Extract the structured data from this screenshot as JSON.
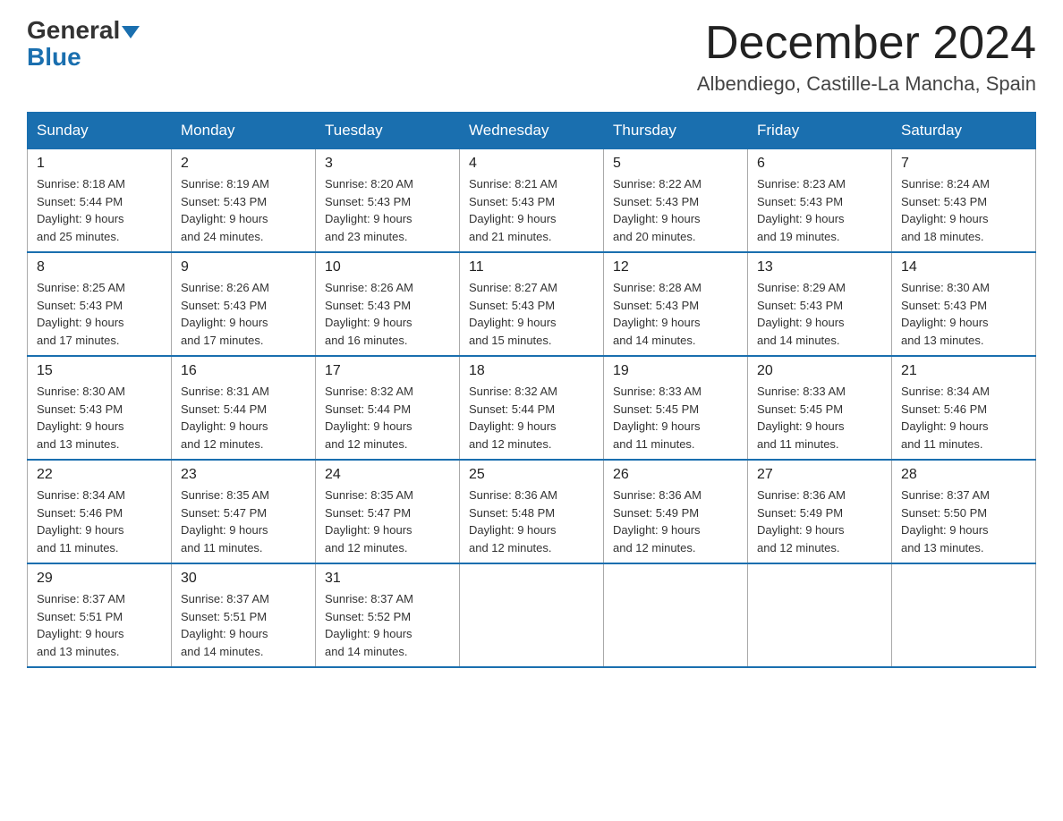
{
  "header": {
    "logo_line1": "General",
    "logo_line2": "Blue",
    "month_title": "December 2024",
    "location": "Albendiego, Castille-La Mancha, Spain"
  },
  "weekdays": [
    "Sunday",
    "Monday",
    "Tuesday",
    "Wednesday",
    "Thursday",
    "Friday",
    "Saturday"
  ],
  "weeks": [
    [
      {
        "day": "1",
        "sunrise": "8:18 AM",
        "sunset": "5:44 PM",
        "daylight": "9 hours and 25 minutes."
      },
      {
        "day": "2",
        "sunrise": "8:19 AM",
        "sunset": "5:43 PM",
        "daylight": "9 hours and 24 minutes."
      },
      {
        "day": "3",
        "sunrise": "8:20 AM",
        "sunset": "5:43 PM",
        "daylight": "9 hours and 23 minutes."
      },
      {
        "day": "4",
        "sunrise": "8:21 AM",
        "sunset": "5:43 PM",
        "daylight": "9 hours and 21 minutes."
      },
      {
        "day": "5",
        "sunrise": "8:22 AM",
        "sunset": "5:43 PM",
        "daylight": "9 hours and 20 minutes."
      },
      {
        "day": "6",
        "sunrise": "8:23 AM",
        "sunset": "5:43 PM",
        "daylight": "9 hours and 19 minutes."
      },
      {
        "day": "7",
        "sunrise": "8:24 AM",
        "sunset": "5:43 PM",
        "daylight": "9 hours and 18 minutes."
      }
    ],
    [
      {
        "day": "8",
        "sunrise": "8:25 AM",
        "sunset": "5:43 PM",
        "daylight": "9 hours and 17 minutes."
      },
      {
        "day": "9",
        "sunrise": "8:26 AM",
        "sunset": "5:43 PM",
        "daylight": "9 hours and 17 minutes."
      },
      {
        "day": "10",
        "sunrise": "8:26 AM",
        "sunset": "5:43 PM",
        "daylight": "9 hours and 16 minutes."
      },
      {
        "day": "11",
        "sunrise": "8:27 AM",
        "sunset": "5:43 PM",
        "daylight": "9 hours and 15 minutes."
      },
      {
        "day": "12",
        "sunrise": "8:28 AM",
        "sunset": "5:43 PM",
        "daylight": "9 hours and 14 minutes."
      },
      {
        "day": "13",
        "sunrise": "8:29 AM",
        "sunset": "5:43 PM",
        "daylight": "9 hours and 14 minutes."
      },
      {
        "day": "14",
        "sunrise": "8:30 AM",
        "sunset": "5:43 PM",
        "daylight": "9 hours and 13 minutes."
      }
    ],
    [
      {
        "day": "15",
        "sunrise": "8:30 AM",
        "sunset": "5:43 PM",
        "daylight": "9 hours and 13 minutes."
      },
      {
        "day": "16",
        "sunrise": "8:31 AM",
        "sunset": "5:44 PM",
        "daylight": "9 hours and 12 minutes."
      },
      {
        "day": "17",
        "sunrise": "8:32 AM",
        "sunset": "5:44 PM",
        "daylight": "9 hours and 12 minutes."
      },
      {
        "day": "18",
        "sunrise": "8:32 AM",
        "sunset": "5:44 PM",
        "daylight": "9 hours and 12 minutes."
      },
      {
        "day": "19",
        "sunrise": "8:33 AM",
        "sunset": "5:45 PM",
        "daylight": "9 hours and 11 minutes."
      },
      {
        "day": "20",
        "sunrise": "8:33 AM",
        "sunset": "5:45 PM",
        "daylight": "9 hours and 11 minutes."
      },
      {
        "day": "21",
        "sunrise": "8:34 AM",
        "sunset": "5:46 PM",
        "daylight": "9 hours and 11 minutes."
      }
    ],
    [
      {
        "day": "22",
        "sunrise": "8:34 AM",
        "sunset": "5:46 PM",
        "daylight": "9 hours and 11 minutes."
      },
      {
        "day": "23",
        "sunrise": "8:35 AM",
        "sunset": "5:47 PM",
        "daylight": "9 hours and 11 minutes."
      },
      {
        "day": "24",
        "sunrise": "8:35 AM",
        "sunset": "5:47 PM",
        "daylight": "9 hours and 12 minutes."
      },
      {
        "day": "25",
        "sunrise": "8:36 AM",
        "sunset": "5:48 PM",
        "daylight": "9 hours and 12 minutes."
      },
      {
        "day": "26",
        "sunrise": "8:36 AM",
        "sunset": "5:49 PM",
        "daylight": "9 hours and 12 minutes."
      },
      {
        "day": "27",
        "sunrise": "8:36 AM",
        "sunset": "5:49 PM",
        "daylight": "9 hours and 12 minutes."
      },
      {
        "day": "28",
        "sunrise": "8:37 AM",
        "sunset": "5:50 PM",
        "daylight": "9 hours and 13 minutes."
      }
    ],
    [
      {
        "day": "29",
        "sunrise": "8:37 AM",
        "sunset": "5:51 PM",
        "daylight": "9 hours and 13 minutes."
      },
      {
        "day": "30",
        "sunrise": "8:37 AM",
        "sunset": "5:51 PM",
        "daylight": "9 hours and 14 minutes."
      },
      {
        "day": "31",
        "sunrise": "8:37 AM",
        "sunset": "5:52 PM",
        "daylight": "9 hours and 14 minutes."
      },
      null,
      null,
      null,
      null
    ]
  ],
  "labels": {
    "sunrise": "Sunrise:",
    "sunset": "Sunset:",
    "daylight": "Daylight:"
  }
}
